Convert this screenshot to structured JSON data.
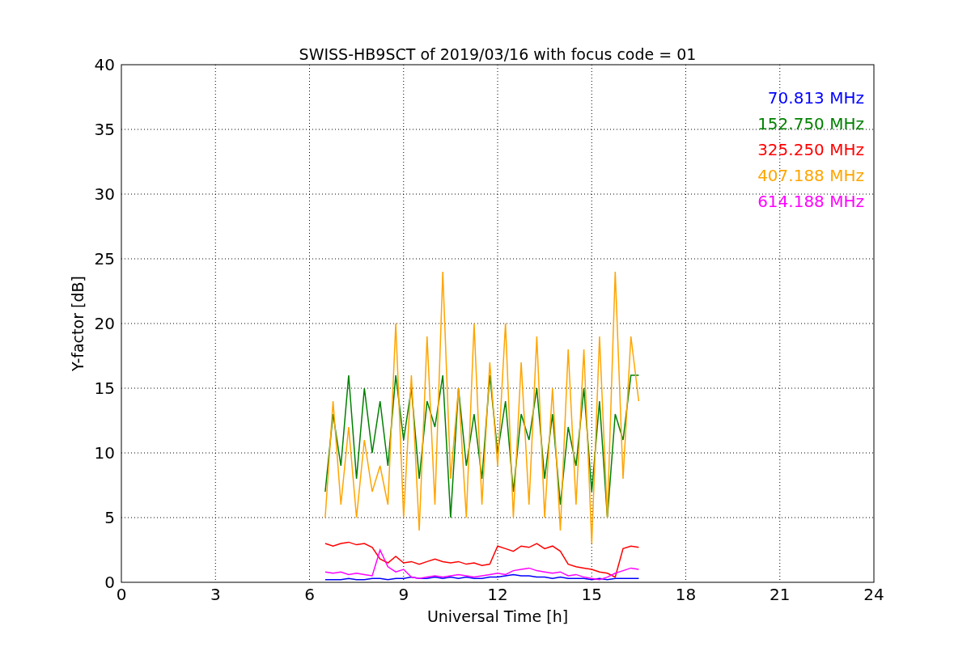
{
  "figure": {
    "chart_data": {
      "type": "line",
      "title": "SWISS-HB9SCT of 2019/03/16 with focus code = 01",
      "xlabel": "Universal Time [h]",
      "ylabel": "Y-factor [dB]",
      "xlim": [
        0,
        24
      ],
      "ylim": [
        0,
        40
      ],
      "xticks": [
        0,
        3,
        6,
        9,
        12,
        15,
        18,
        21,
        24
      ],
      "yticks": [
        0,
        5,
        10,
        15,
        20,
        25,
        30,
        35,
        40
      ],
      "grid": true,
      "x": [
        6.5,
        6.75,
        7,
        7.25,
        7.5,
        7.75,
        8,
        8.25,
        8.5,
        8.75,
        9,
        9.25,
        9.5,
        9.75,
        10,
        10.25,
        10.5,
        10.75,
        11,
        11.25,
        11.5,
        11.75,
        12,
        12.25,
        12.5,
        12.75,
        13,
        13.25,
        13.5,
        13.75,
        14,
        14.25,
        14.5,
        14.75,
        15,
        15.25,
        15.5,
        15.75,
        16,
        16.25,
        16.5
      ],
      "series": [
        {
          "name": "70.813 MHz",
          "color": "#0000ff",
          "values": [
            0.2,
            0.2,
            0.2,
            0.3,
            0.2,
            0.2,
            0.3,
            0.3,
            0.2,
            0.3,
            0.3,
            0.4,
            0.3,
            0.3,
            0.4,
            0.3,
            0.4,
            0.3,
            0.4,
            0.3,
            0.3,
            0.4,
            0.4,
            0.5,
            0.6,
            0.5,
            0.5,
            0.4,
            0.4,
            0.3,
            0.4,
            0.3,
            0.3,
            0.3,
            0.2,
            0.3,
            0.2,
            0.3,
            0.3,
            0.3,
            0.3
          ]
        },
        {
          "name": "152.750 MHz",
          "color": "#008000",
          "values": [
            7,
            13,
            9,
            16,
            8,
            15,
            10,
            14,
            9,
            16,
            11,
            15,
            8,
            14,
            12,
            16,
            5,
            15,
            9,
            13,
            8,
            16,
            10,
            14,
            7,
            13,
            11,
            15,
            8,
            13,
            6,
            12,
            9,
            15,
            7,
            14,
            5,
            13,
            11,
            16,
            16
          ]
        },
        {
          "name": "325.250 MHz",
          "color": "#ff0000",
          "values": [
            3,
            2.8,
            3,
            3.1,
            2.9,
            3,
            2.7,
            1.8,
            1.5,
            2,
            1.5,
            1.6,
            1.4,
            1.6,
            1.8,
            1.6,
            1.5,
            1.6,
            1.4,
            1.5,
            1.3,
            1.4,
            2.8,
            2.6,
            2.4,
            2.8,
            2.7,
            3,
            2.6,
            2.8,
            2.4,
            1.4,
            1.2,
            1.1,
            1,
            0.8,
            0.7,
            0.4,
            2.6,
            2.8,
            2.7
          ]
        },
        {
          "name": "407.188 MHz",
          "color": "#ffa500",
          "values": [
            5,
            14,
            6,
            12,
            5,
            11,
            7,
            9,
            6,
            20,
            5,
            16,
            4,
            19,
            6,
            24,
            8,
            15,
            5,
            20,
            6,
            17,
            9,
            20,
            5,
            17,
            6,
            19,
            5,
            15,
            4,
            18,
            6,
            18,
            3,
            19,
            5,
            24,
            8,
            19,
            14
          ]
        },
        {
          "name": "614.188 MHz",
          "color": "#ff00ff",
          "values": [
            0.8,
            0.7,
            0.8,
            0.6,
            0.7,
            0.6,
            0.5,
            2.5,
            1.2,
            0.8,
            1,
            0.4,
            0.3,
            0.4,
            0.5,
            0.4,
            0.5,
            0.6,
            0.5,
            0.4,
            0.5,
            0.6,
            0.7,
            0.6,
            0.9,
            1,
            1.1,
            0.9,
            0.8,
            0.7,
            0.8,
            0.5,
            0.6,
            0.4,
            0.3,
            0.2,
            0.4,
            0.7,
            0.9,
            1.1,
            1
          ]
        }
      ]
    }
  }
}
